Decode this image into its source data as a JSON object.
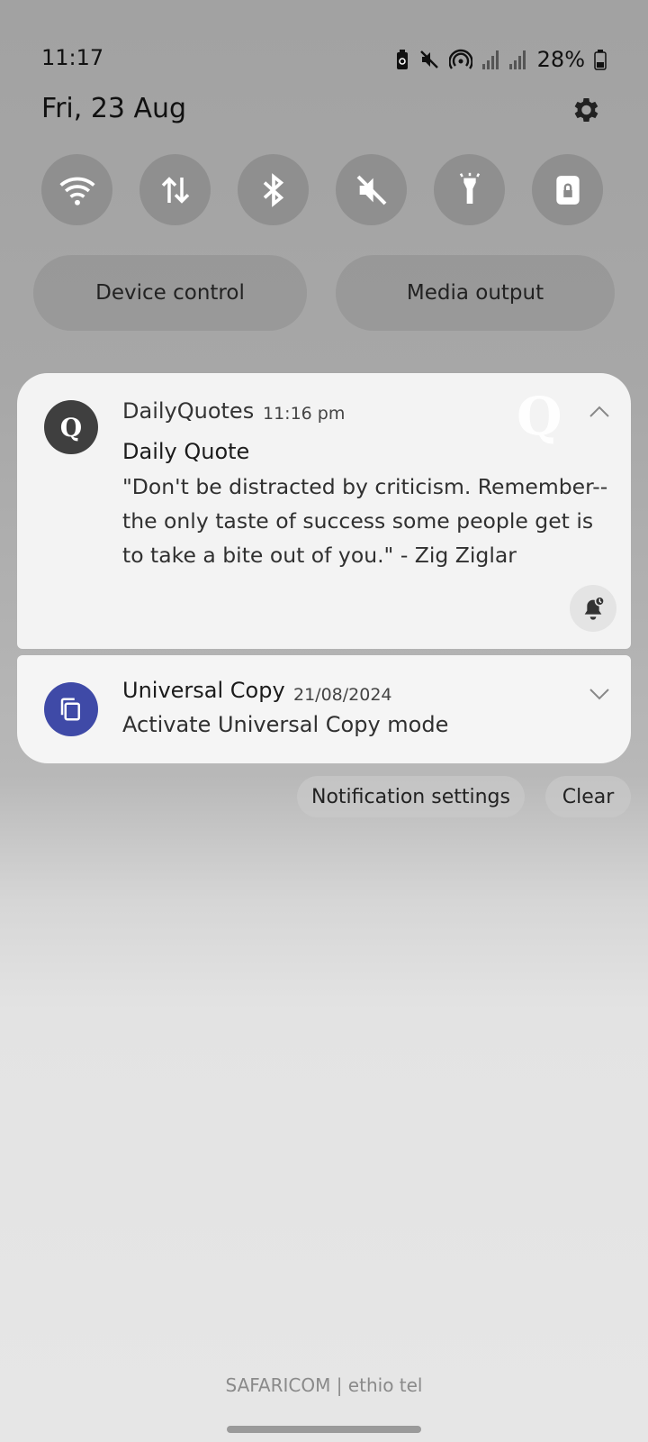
{
  "status_bar": {
    "time": "11:17",
    "battery_percent": "28%",
    "icons": [
      "battery-saver-icon",
      "mute-icon",
      "hotspot-icon",
      "signal-1-icon",
      "signal-2-icon",
      "battery-icon"
    ]
  },
  "header": {
    "date": "Fri, 23 Aug",
    "settings_icon": "gear-icon"
  },
  "quick_settings": {
    "tiles": [
      {
        "name": "wifi",
        "icon": "wifi-icon"
      },
      {
        "name": "mobile-data",
        "icon": "data-arrows-icon"
      },
      {
        "name": "bluetooth",
        "icon": "bluetooth-icon"
      },
      {
        "name": "sound",
        "icon": "mute-icon"
      },
      {
        "name": "flashlight",
        "icon": "flashlight-icon"
      },
      {
        "name": "screen-lock",
        "icon": "lock-icon"
      }
    ],
    "device_control_label": "Device control",
    "media_output_label": "Media output"
  },
  "notifications": [
    {
      "app_name": "DailyQuotes",
      "avatar_letter": "Q",
      "time": "11:16 pm",
      "title": "Daily Quote",
      "body": "\"Don't be distracted by criticism. Remember--the only taste of success some people get is to take a bite out of you.\" - Zig Ziglar",
      "watermark": "Q",
      "expanded": true
    },
    {
      "app_name": "Universal Copy",
      "time": "21/08/2024",
      "body": "Activate Universal Copy mode",
      "icon": "copy-icon",
      "expanded": false
    }
  ],
  "actions": {
    "notification_settings_label": "Notification settings",
    "clear_label": "Clear"
  },
  "footer": {
    "carrier": "SAFARICOM | ethio tel"
  },
  "colors": {
    "universal_copy_accent": "#3f4aa7",
    "dailyquotes_avatar": "#3f3f3f"
  }
}
